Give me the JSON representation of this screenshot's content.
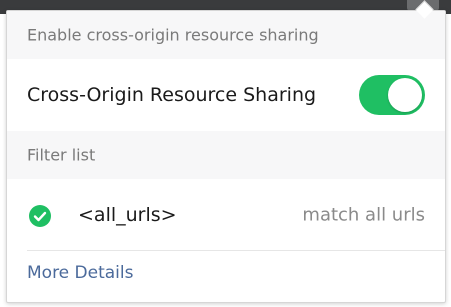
{
  "popup": {
    "sections": {
      "cors_header": "Enable cross-origin resource sharing",
      "filter_header": "Filter list"
    },
    "cors": {
      "label": "Cross-Origin Resource Sharing",
      "enabled": true
    },
    "filters": [
      {
        "pattern": "<all_urls>",
        "description": "match all urls",
        "checked": true
      }
    ],
    "more_details": "More Details"
  },
  "icons": {
    "check": "check-circle-icon"
  },
  "colors": {
    "toggle_on": "#1fbf63",
    "link": "#4b6a9b",
    "header_bg": "#f7f7f8",
    "topbar": "#3a3b3d"
  }
}
